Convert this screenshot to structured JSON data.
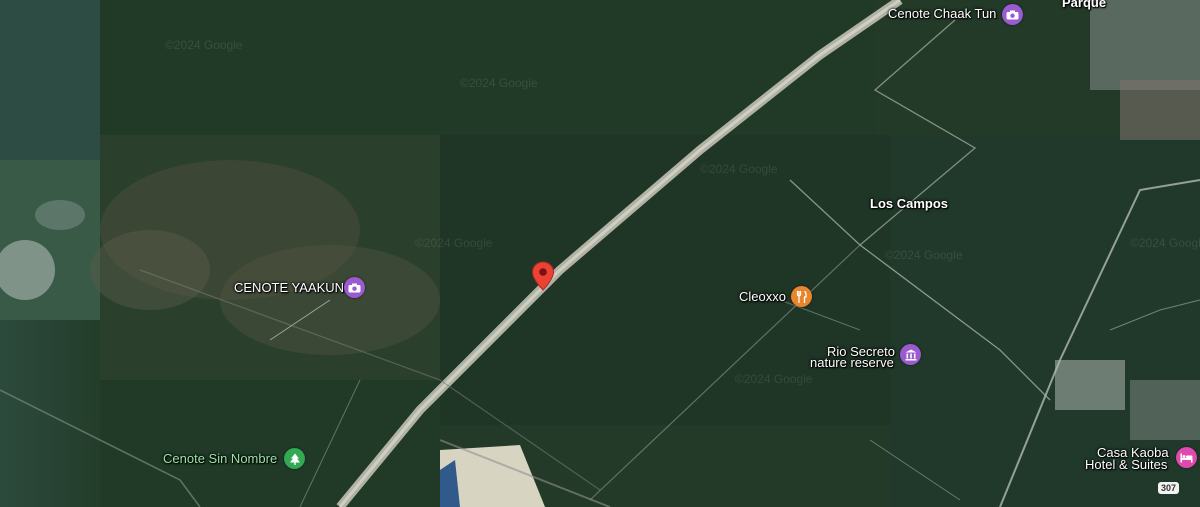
{
  "map": {
    "type": "satellite",
    "place_labels": {
      "cenote_chaak_tun": "Cenote Chaak Tun",
      "parque": "Parque",
      "los_campos": "Los Campos",
      "cenote_yaakun": "CENOTE YAAKUN",
      "cleoxxo": "Cleoxxo",
      "rio_secreto_line1": "Rio Secreto",
      "rio_secreto_line2": "nature reserve",
      "cenote_sin_nombre": "Cenote Sin Nombre",
      "casa_kaoba_line1": "Casa Kaoba",
      "casa_kaoba_line2": "Hotel & Suites"
    },
    "highway_shield": "307",
    "watermark": "©2024 Google",
    "icons": {
      "cenote_chaak_tun": "camera-icon",
      "cenote_yaakun": "camera-icon",
      "cleoxxo": "restaurant-icon",
      "rio_secreto": "landmark-icon",
      "cenote_sin_nombre": "park-icon",
      "casa_kaoba": "hotel-icon",
      "pin": "location-pin-icon"
    },
    "colors": {
      "attraction": "#9a5ad0",
      "restaurant": "#e8862c",
      "park": "#34a853",
      "hotel": "#e04ab0",
      "pin": "#ea4335"
    }
  }
}
